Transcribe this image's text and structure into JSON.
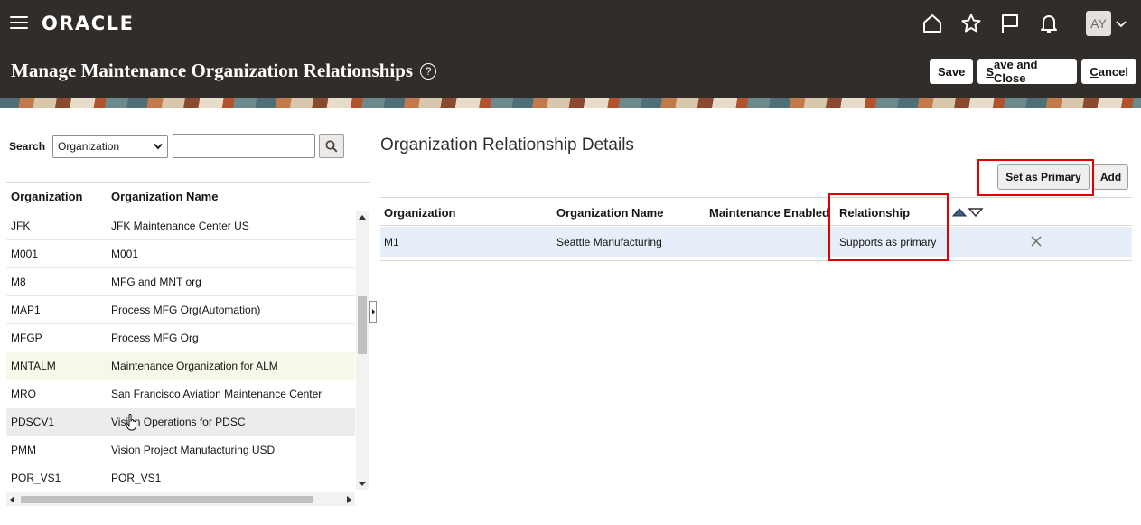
{
  "header": {
    "logo": "ORACLE",
    "page_title": "Manage Maintenance Organization Relationships",
    "help_glyph": "?",
    "avatar_initials": "AY",
    "icons": [
      "menu-icon",
      "home-icon",
      "star-icon",
      "flag-icon",
      "bell-icon",
      "chevron-down-icon"
    ],
    "buttons": {
      "save": "Save",
      "save_and_close_first": "S",
      "save_and_close_rest": "ave and Close",
      "cancel_first": "C",
      "cancel_rest": "ancel"
    }
  },
  "left_panel": {
    "search": {
      "label": "Search",
      "selected_option": "Organization",
      "input_value": "",
      "search_icon": "magnifier-icon"
    },
    "columns": [
      "Organization",
      "Organization Name"
    ],
    "rows": [
      {
        "code": "JFK",
        "name": "JFK Maintenance Center US"
      },
      {
        "code": "M001",
        "name": "M001"
      },
      {
        "code": "M8",
        "name": "MFG and MNT org"
      },
      {
        "code": "MAP1",
        "name": "Process MFG Org(Automation)"
      },
      {
        "code": "MFGP",
        "name": "Process MFG Org"
      },
      {
        "code": "MNTALM",
        "name": "Maintenance Organization for ALM"
      },
      {
        "code": "MRO",
        "name": "San Francisco Aviation Maintenance Center"
      },
      {
        "code": "PDSCV1",
        "name": "Vision Operations for PDSC"
      },
      {
        "code": "PMM",
        "name": "Vision Project Manufacturing USD"
      },
      {
        "code": "POR_VS1",
        "name": "POR_VS1"
      }
    ],
    "selected_row": "MNTALM",
    "hovered_row": "PDSCV1"
  },
  "right_panel": {
    "title": "Organization Relationship Details",
    "buttons": {
      "set_as_primary": "Set as Primary",
      "add": "Add"
    },
    "columns": [
      "Organization",
      "Organization Name",
      "Maintenance Enabled",
      "Relationship"
    ],
    "rows": [
      {
        "organization": "M1",
        "organization_name": "Seattle Manufacturing",
        "maintenance_enabled": "",
        "relationship": "Supports as primary"
      }
    ]
  },
  "colors": {
    "header_bg": "#312d2a",
    "highlight_red": "#e00000",
    "selected_row_bg": "#e5eef9"
  }
}
